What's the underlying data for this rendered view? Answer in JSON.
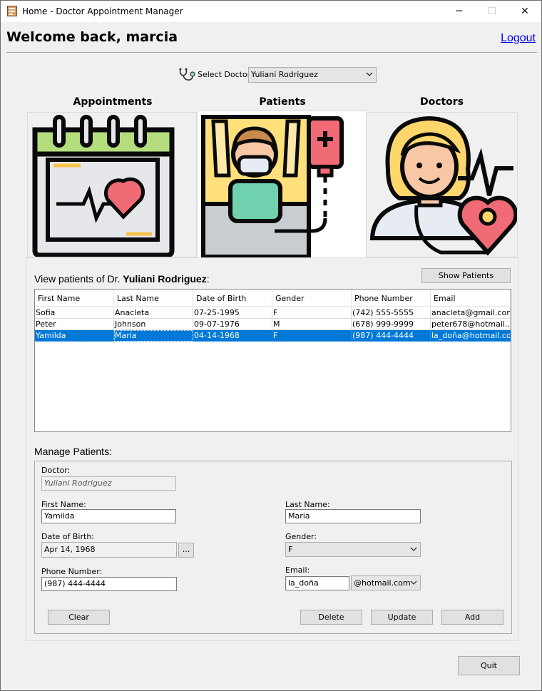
{
  "window": {
    "title": "Home - Doctor Appointment Manager"
  },
  "header": {
    "welcome": "Welcome back, marcia",
    "logout": "Logout"
  },
  "doctor_select": {
    "label": "Select Doctor:",
    "value": "Yuliani Rodriguez"
  },
  "tabs": [
    {
      "label": "Appointments",
      "icon": "calendar-heart-icon"
    },
    {
      "label": "Patients",
      "icon": "patient-bed-icon"
    },
    {
      "label": "Doctors",
      "icon": "doctor-icon"
    }
  ],
  "patients_view": {
    "prefix": "View patients of Dr.",
    "doctor": "Yuliani Rodriguez",
    "suffix": ":",
    "show_button": "Show Patients",
    "columns": [
      "First Name",
      "Last Name",
      "Date of Birth",
      "Gender",
      "Phone Number",
      "Email"
    ],
    "rows": [
      [
        "Sofia",
        "Anacleta",
        "07-25-1995",
        "F",
        "(742) 555-5555",
        "anacleta@gmail.com"
      ],
      [
        "Peter",
        "Johnson",
        "09-07-1976",
        "M",
        "(678) 999-9999",
        "peter678@hotmail...."
      ],
      [
        "Yamilda",
        "Maria",
        "04-14-1968",
        "F",
        "(987) 444-4444",
        "la_doña@hotmail.com"
      ]
    ],
    "selected_row": 2
  },
  "manage": {
    "title": "Manage Patients:",
    "doctor_label": "Doctor:",
    "doctor_value": "Yuliani Rodriguez",
    "first_name_label": "First Name:",
    "first_name_value": "Yamilda",
    "last_name_label": "Last Name:",
    "last_name_value": "Maria",
    "dob_label": "Date of Birth:",
    "dob_value": "Apr 14, 1968",
    "dob_button": "...",
    "gender_label": "Gender:",
    "gender_value": "F",
    "phone_label": "Phone Number:",
    "phone_value": "(987) 444-4444",
    "email_label": "Email:",
    "email_user": "la_doña",
    "email_domain": "@hotmail.com",
    "clear": "Clear",
    "delete": "Delete",
    "update": "Update",
    "add": "Add"
  },
  "footer": {
    "quit": "Quit"
  }
}
